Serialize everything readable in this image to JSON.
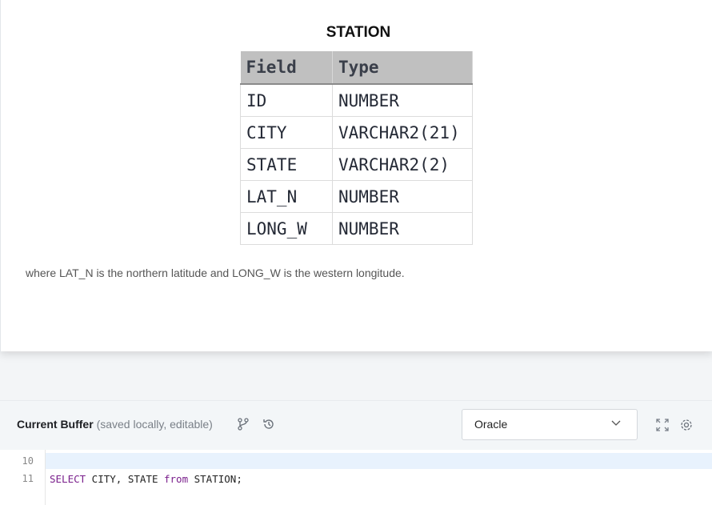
{
  "problem": {
    "table_title": "STATION",
    "columns": [
      "Field",
      "Type"
    ],
    "rows": [
      [
        "ID",
        "NUMBER"
      ],
      [
        "CITY",
        "VARCHAR2(21)"
      ],
      [
        "STATE",
        "VARCHAR2(2)"
      ],
      [
        "LAT_N",
        "NUMBER"
      ],
      [
        "LONG_W",
        "NUMBER"
      ]
    ],
    "description": "where LAT_N is the northern latitude and LONG_W is the western longitude."
  },
  "buffer": {
    "title": "Current Buffer",
    "subtitle": "(saved locally, editable)",
    "language": "Oracle",
    "icons": [
      "branch-icon",
      "history-icon",
      "chevron-down-icon",
      "fullscreen-icon",
      "gear-icon"
    ]
  },
  "editor": {
    "line_numbers": [
      "10",
      "11"
    ],
    "code": {
      "kw1": "SELECT",
      "t1": " CITY, STATE ",
      "kw2": "from",
      "t2": " STATION;"
    }
  }
}
